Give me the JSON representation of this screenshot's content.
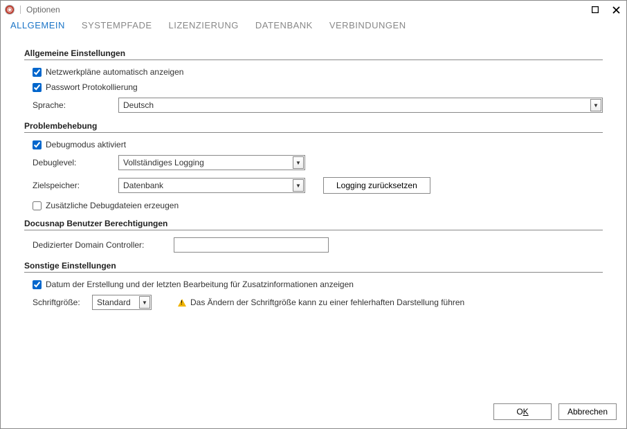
{
  "window": {
    "title": "Optionen"
  },
  "tabs": {
    "allgemein": "ALLGEMEIN",
    "systempfade": "SYSTEMPFADE",
    "lizenzierung": "LIZENZIERUNG",
    "datenbank": "DATENBANK",
    "verbindungen": "VERBINDUNGEN"
  },
  "sections": {
    "general": {
      "header": "Allgemeine Einstellungen",
      "cb_network": "Netzwerkpläne automatisch anzeigen",
      "cb_password": "Passwort Protokollierung",
      "language_label": "Sprache:",
      "language_value": "Deutsch"
    },
    "trouble": {
      "header": "Problembehebung",
      "cb_debug": "Debugmodus aktiviert",
      "debuglevel_label": "Debuglevel:",
      "debuglevel_value": "Vollständiges Logging",
      "target_label": "Zielspeicher:",
      "target_value": "Datenbank",
      "reset_button": "Logging zurücksetzen",
      "cb_extrafiles": "Zusätzliche Debugdateien erzeugen"
    },
    "perms": {
      "header": "Docusnap Benutzer Berechtigungen",
      "dc_label": "Dedizierter Domain Controller:",
      "dc_value": ""
    },
    "other": {
      "header": "Sonstige Einstellungen",
      "cb_dates": "Datum der Erstellung und der letzten Bearbeitung für Zusatzinformationen anzeigen",
      "fontsize_label": "Schriftgröße:",
      "fontsize_value": "Standard",
      "warn_text": "Das Ändern der Schriftgröße kann zu einer fehlerhaften Darstellung führen"
    }
  },
  "footer": {
    "ok_prefix": "O",
    "ok_key": "K",
    "cancel": "Abbrechen"
  }
}
